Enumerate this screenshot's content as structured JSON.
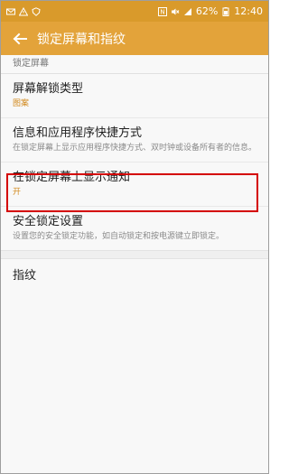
{
  "status_bar": {
    "battery": "62%",
    "time": "12:40"
  },
  "app_bar": {
    "title": "锁定屏幕和指纹"
  },
  "section": {
    "header": "锁定屏幕"
  },
  "items": [
    {
      "title": "屏幕解锁类型",
      "subtitle": "图案"
    },
    {
      "title": "信息和应用程序快捷方式",
      "subtitle": "在锁定屏幕上显示应用程序快捷方式、双时钟或设备所有者的信息。"
    },
    {
      "title": "在锁定屏幕上显示通知",
      "subtitle": "开"
    },
    {
      "title": "安全锁定设置",
      "subtitle": "设置您的安全锁定功能，如自动锁定和按电源键立即锁定。"
    },
    {
      "title": "指纹",
      "subtitle": ""
    }
  ],
  "colors": {
    "status_bar": "#d99a2b",
    "app_bar": "#e3a33a",
    "accent_text": "#d28a1f",
    "highlight": "#d40000"
  }
}
